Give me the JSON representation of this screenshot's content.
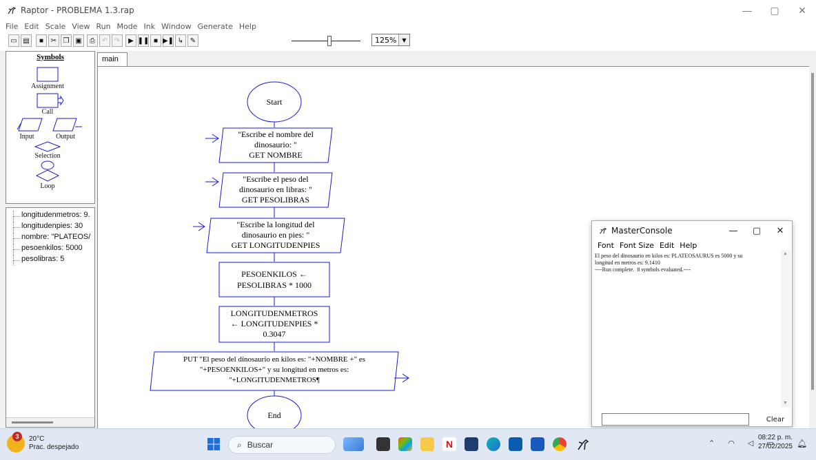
{
  "window": {
    "title": "Raptor - PROBLEMA 1.3.rap",
    "controls": [
      "—",
      "▢",
      "✕"
    ]
  },
  "menu": [
    "File",
    "Edit",
    "Scale",
    "View",
    "Run",
    "Mode",
    "Ink",
    "Window",
    "Generate",
    "Help"
  ],
  "toolbar": {
    "zoom_value": "125%",
    "buttons": [
      "new",
      "open",
      "save",
      "cut",
      "copy",
      "paste",
      "print",
      "undo",
      "redo",
      "run",
      "pause",
      "stop",
      "step",
      "step-to-completion",
      "pen"
    ]
  },
  "symbols_panel": {
    "header": "Symbols",
    "items": [
      "Assignment",
      "Call",
      "Input",
      "Output",
      "Selection",
      "Loop"
    ]
  },
  "variables": [
    "longitudenmetros: 9.",
    "longitudenpies: 30",
    "nombre: \"PLATEOS/",
    "pesoenkilos: 5000",
    "pesolibras: 5"
  ],
  "tabs": [
    "main"
  ],
  "flowchart": {
    "start": "Start",
    "end": "End",
    "input1": [
      "\"Escribe el nombre del",
      "dinosaurio: \"",
      "GET NOMBRE"
    ],
    "input2": [
      "\"Escribe el peso del",
      "dinosaurio en libras: \"",
      "GET PESOLIBRAS"
    ],
    "input3": [
      "\"Escribe la longitud del",
      "dinosaurio en pies: \"",
      "GET LONGITUDENPIES"
    ],
    "assign1": [
      "PESOENKILOS ←",
      "PESOLIBRAS * 1000"
    ],
    "assign2": [
      "LONGITUDENMETROS",
      "← LONGITUDENPIES *",
      "0.3047"
    ],
    "output": [
      "PUT \"El peso del dinosaurio en kilos es: \"+NOMBRE +\" es",
      "\"+PESOENKILOS+\" y su longitud en metros es:",
      "\"+LONGITUDENMETROS¶"
    ]
  },
  "console": {
    "title": "MasterConsole",
    "menu": [
      "Font",
      "Font Size",
      "Edit",
      "Help"
    ],
    "lines": [
      "El peso del dinosaurio en kilos es: PLATEOSAURUS es 5000 y su",
      "longitud en metros es: 9.1410",
      "----Run complete.  8 symbols evaluated.----"
    ],
    "clear_label": "Clear"
  },
  "taskbar": {
    "temperature": "20°C",
    "weather": "Prac. despejado",
    "weather_badge": "3",
    "search_placeholder": "Buscar",
    "time": "08:22 p. m.",
    "date": "27/02/2025"
  },
  "colors": {
    "flow_line": "#1a1ac8",
    "taskbar": "#dfe8f3"
  }
}
